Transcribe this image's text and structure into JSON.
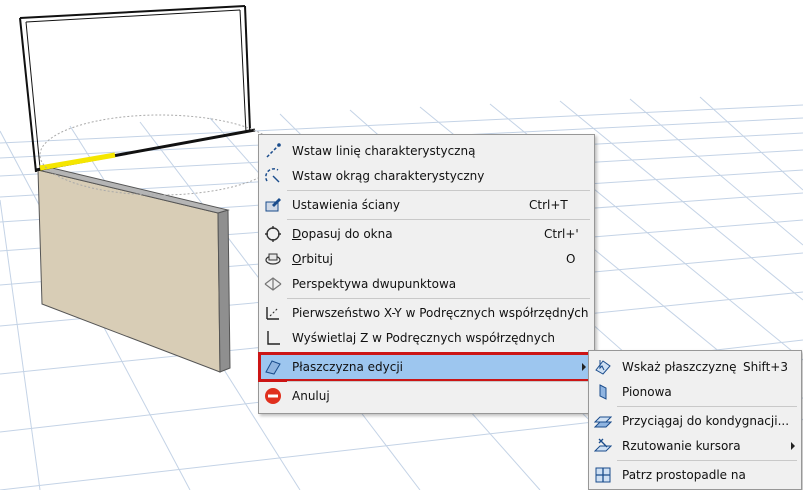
{
  "context_menu": {
    "items": [
      {
        "label": "Wstaw linię charakterystyczną",
        "shortcut": "",
        "icon": "insert-line-icon"
      },
      {
        "label": "Wstaw okrąg charakterystyczny",
        "shortcut": "",
        "icon": "insert-circle-icon"
      },
      {
        "label": "Ustawienia ściany",
        "shortcut": "Ctrl+T",
        "icon": "wall-settings-icon"
      },
      {
        "label_u": "D",
        "label_rest": "opasuj do okna",
        "shortcut": "Ctrl+'",
        "icon": "fit-window-icon"
      },
      {
        "label_u": "O",
        "label_rest": "rbituj",
        "shortcut": "O",
        "icon": "orbit-icon"
      },
      {
        "label": "Perspektywa dwupunktowa",
        "shortcut": "",
        "icon": "two-point-perspective-icon"
      },
      {
        "label": "Pierwszeństwo X-Y w Podręcznych współrzędnych",
        "shortcut": "/",
        "icon": "xy-priority-icon"
      },
      {
        "label": "Wyświetlaj Z w Podręcznych współrzędnych",
        "shortcut": "",
        "icon": "show-z-icon"
      },
      {
        "label": "Płaszczyzna edycji",
        "shortcut": "",
        "icon": "editing-plane-icon",
        "highlighted": true
      },
      {
        "label": "Anuluj",
        "shortcut": "",
        "icon": "cancel-icon"
      }
    ]
  },
  "submenu": {
    "items": [
      {
        "label": "Wskaż płaszczyznę",
        "shortcut": "Shift+3",
        "icon": "pick-plane-icon"
      },
      {
        "label": "Pionowa",
        "shortcut": "",
        "icon": "vertical-plane-icon"
      },
      {
        "label": "Przyciągaj do kondygnacji...",
        "shortcut": "",
        "icon": "snap-story-icon"
      },
      {
        "label": "Rzutowanie kursora",
        "shortcut": "",
        "icon": "cursor-projection-icon"
      },
      {
        "label": "Patrz prostopadle na",
        "shortcut": "",
        "icon": "look-perpendicular-icon"
      }
    ]
  },
  "colors": {
    "highlight": "#9dc6ef",
    "highlight_border": "#cc1515",
    "wall_face": "#d8cdb6",
    "grid_line": "#bfcfe4",
    "cancel_red": "#e0301e"
  }
}
